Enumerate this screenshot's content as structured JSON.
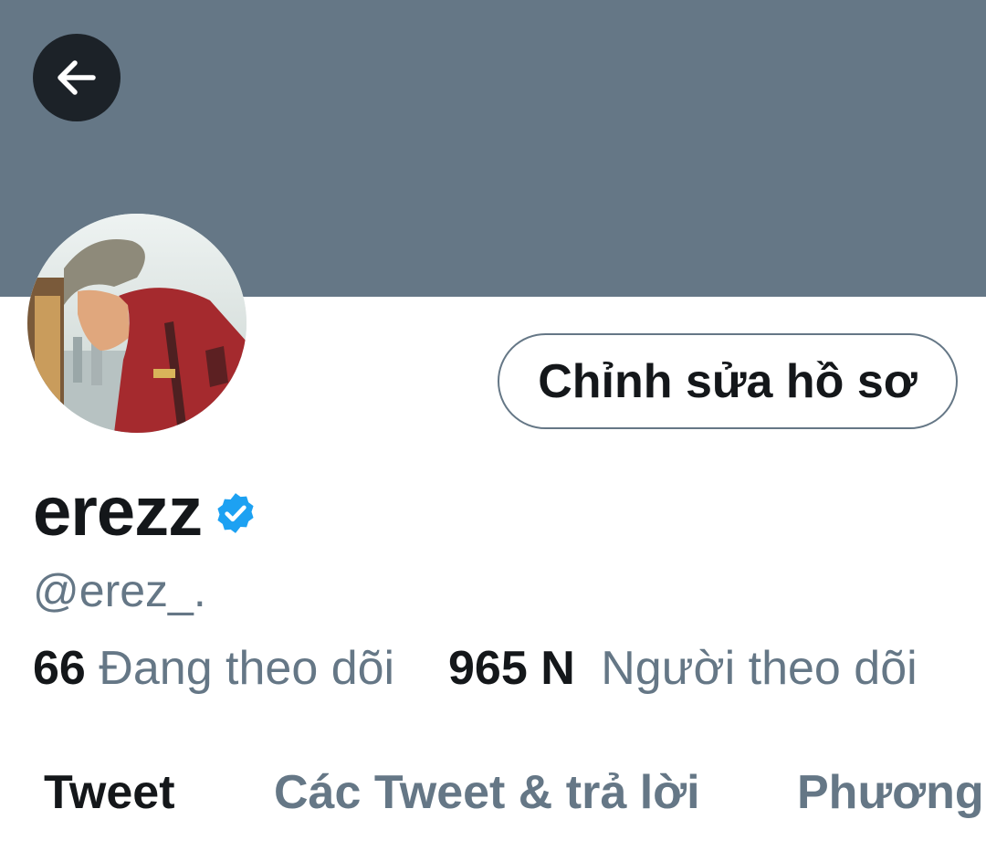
{
  "header": {
    "back_icon": "arrow-left-icon"
  },
  "profile": {
    "edit_button_label": "Chỉnh sửa hồ sơ",
    "display_name": "erezz",
    "verified_icon": "verified-badge-icon",
    "handle": "@erez_.",
    "following_count": "66",
    "following_label": "Đang theo dõi",
    "followers_count": "965 N",
    "followers_label": "Người theo dõi"
  },
  "tabs": [
    {
      "label": "Tweet",
      "active": true
    },
    {
      "label": "Các Tweet & trả lời",
      "active": false
    },
    {
      "label": "Phương",
      "active": false
    }
  ],
  "colors": {
    "banner": "#657786",
    "verified": "#1da1f2",
    "text_primary": "#14171a",
    "text_secondary": "#657786"
  }
}
